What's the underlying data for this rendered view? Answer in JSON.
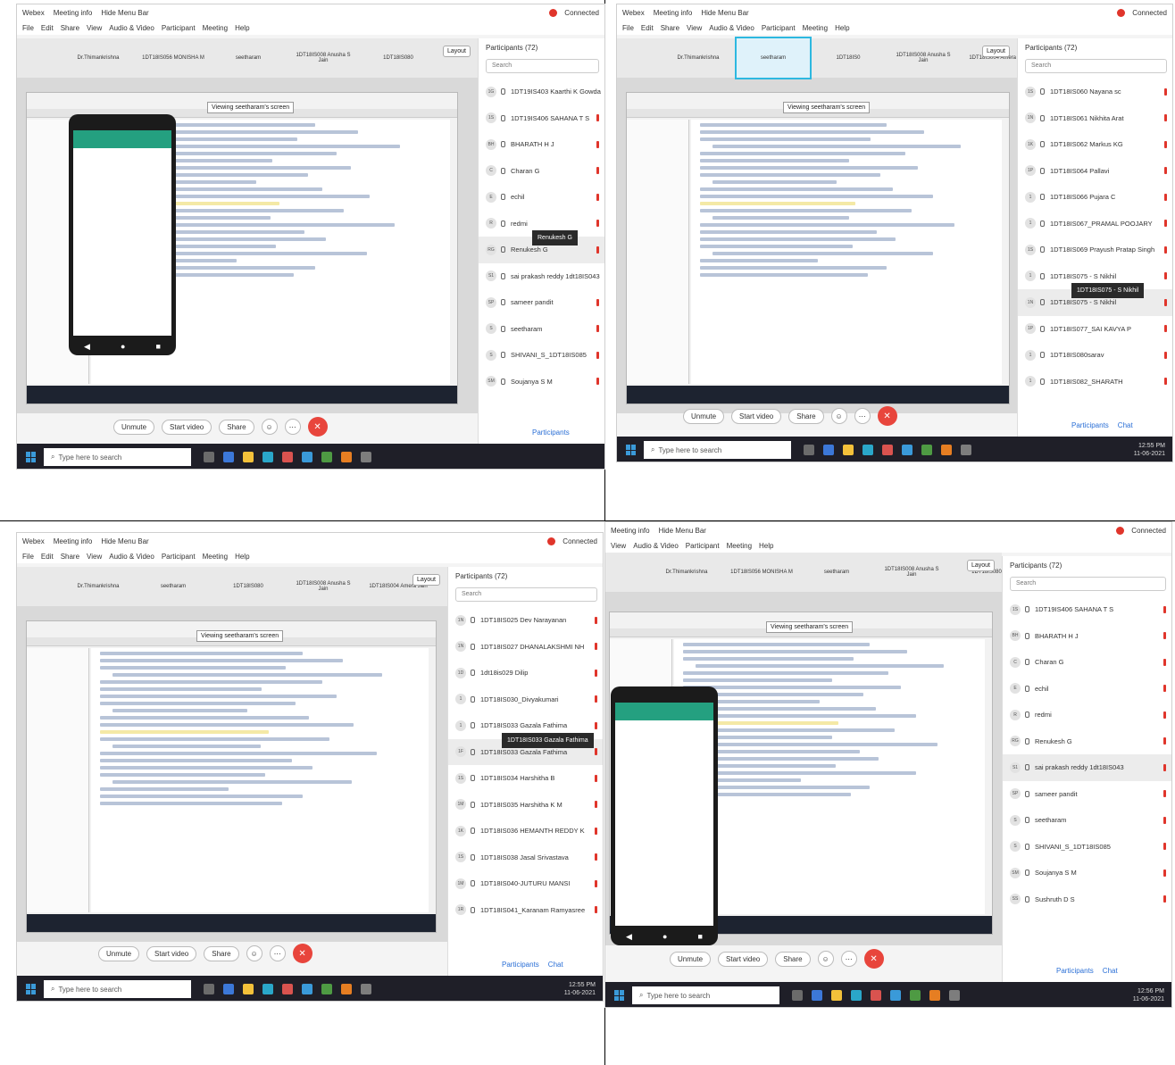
{
  "quadrants": [
    {
      "titlebar": {
        "app": "Webex",
        "meeting_info": "Meeting info",
        "hide_menu": "Hide Menu Bar",
        "status": "Connected"
      },
      "menu": [
        "File",
        "Edit",
        "Share",
        "View",
        "Audio & Video",
        "Participant",
        "Meeting",
        "Help"
      ],
      "thumbs": [
        "Dr.Thimankrishna",
        "1DT18IS056 MONISHA M",
        "seetharam",
        "1DT18IS008 Anusha S Jain",
        "1DT18IS080"
      ],
      "selected_thumb": -1,
      "layout_label": "Layout",
      "banner": "Viewing seetharam's screen",
      "show_phone": true,
      "controls": {
        "unmute": "Unmute",
        "start_video": "Start video",
        "share": "Share",
        "participants": "Participants",
        "chat": ""
      },
      "panel": {
        "title": "Participants (72)",
        "search": "Search",
        "rows": [
          {
            "av": "1G",
            "name": "1DT19IS403 Kaarthi K Gowda"
          },
          {
            "av": "1S",
            "name": "1DT19IS406 SAHANA T S"
          },
          {
            "av": "BH",
            "name": "BHARATH H J"
          },
          {
            "av": "C",
            "name": "Charan G"
          },
          {
            "av": "E",
            "name": "echil"
          },
          {
            "av": "R",
            "name": "redmi"
          },
          {
            "av": "RG",
            "name": "Renukesh G"
          },
          {
            "av": "S1",
            "name": "sai prakash reddy 1dt18IS043"
          },
          {
            "av": "SP",
            "name": "sameer pandit"
          },
          {
            "av": "S",
            "name": "seetharam"
          },
          {
            "av": "S",
            "name": "SHIVANI_S_1DT18IS085"
          },
          {
            "av": "SM",
            "name": "Soujanya S M"
          }
        ],
        "hover_index": 6,
        "tooltip": "Renukesh G"
      },
      "taskbar": {
        "search": "Type here to search",
        "time": "",
        "date": ""
      }
    },
    {
      "titlebar": {
        "app": "Webex",
        "meeting_info": "Meeting info",
        "hide_menu": "Hide Menu Bar",
        "status": "Connected"
      },
      "menu": [
        "File",
        "Edit",
        "Share",
        "View",
        "Audio & Video",
        "Participant",
        "Meeting",
        "Help"
      ],
      "thumbs": [
        "Dr.Thimankrishna",
        "seetharam",
        "1DT18IS0",
        "1DT18IS008 Anusha S Jain",
        "1DT18IS004 Amera Jain"
      ],
      "selected_thumb": 1,
      "layout_label": "Layout",
      "banner": "Viewing seetharam's screen",
      "show_phone": false,
      "controls": {
        "unmute": "Unmute",
        "start_video": "Start video",
        "share": "Share",
        "participants": "Participants",
        "chat": "Chat"
      },
      "panel": {
        "title": "Participants (72)",
        "search": "Search",
        "rows": [
          {
            "av": "1S",
            "name": "1DT18IS060 Nayana sc"
          },
          {
            "av": "1N",
            "name": "1DT18IS061 Nikhita Arat"
          },
          {
            "av": "1K",
            "name": "1DT18IS062 Markus KG"
          },
          {
            "av": "1P",
            "name": "1DT18IS064 Pallavi"
          },
          {
            "av": "1",
            "name": "1DT18IS066 Pujara C"
          },
          {
            "av": "1",
            "name": "1DT18IS067_PRAMAL POOJARY"
          },
          {
            "av": "1S",
            "name": "1DT18IS069 Prayush Pratap Singh"
          },
          {
            "av": "1",
            "name": "1DT18IS075 - S Nikhil"
          },
          {
            "av": "1N",
            "name": "1DT18IS075 - S Nikhil"
          },
          {
            "av": "1P",
            "name": "1DT18IS077_SAI KAVYA P"
          },
          {
            "av": "1",
            "name": "1DT18IS080sarav"
          },
          {
            "av": "1",
            "name": "1DT18IS082_SHARATH"
          }
        ],
        "hover_index": 8,
        "tooltip": "1DT18IS075 - S Nikhil"
      },
      "taskbar": {
        "search": "Type here to search",
        "time": "12:55 PM",
        "date": "11-06-2021"
      }
    },
    {
      "titlebar": {
        "app": "Webex",
        "meeting_info": "Meeting info",
        "hide_menu": "Hide Menu Bar",
        "status": "Connected"
      },
      "menu": [
        "File",
        "Edit",
        "Share",
        "View",
        "Audio & Video",
        "Participant",
        "Meeting",
        "Help"
      ],
      "thumbs": [
        "Dr.Thimankrishna",
        "seetharam",
        "1DT18IS080",
        "1DT18IS008 Anusha S Jain",
        "1DT18IS004 Amera Jain"
      ],
      "selected_thumb": -1,
      "layout_label": "Layout",
      "banner": "Viewing seetharam's screen",
      "show_phone": false,
      "controls": {
        "unmute": "Unmute",
        "start_video": "Start video",
        "share": "Share",
        "participants": "Participants",
        "chat": "Chat"
      },
      "panel": {
        "title": "Participants (72)",
        "search": "Search",
        "rows": [
          {
            "av": "1N",
            "name": "1DT18IS025 Dev Narayanan"
          },
          {
            "av": "1N",
            "name": "1DT18IS027 DHANALAKSHMI NH"
          },
          {
            "av": "1D",
            "name": "1dt18is029 Dilip"
          },
          {
            "av": "1",
            "name": "1DT18IS030_Divyakumari"
          },
          {
            "av": "1",
            "name": "1DT18IS033 Gazala Fathima"
          },
          {
            "av": "1F",
            "name": "1DT18IS033 Gazala Fathima"
          },
          {
            "av": "1S",
            "name": "1DT18IS034 Harshitha B"
          },
          {
            "av": "1M",
            "name": "1DT18IS035 Harshitha K M"
          },
          {
            "av": "1K",
            "name": "1DT18IS036 HEMANTH REDDY K"
          },
          {
            "av": "1S",
            "name": "1DT18IS038 Jasal Srivastava"
          },
          {
            "av": "1M",
            "name": "1DT18IS040-JUTURU MANSI"
          },
          {
            "av": "1R",
            "name": "1DT18IS041_Karanam Ramyasree"
          }
        ],
        "hover_index": 5,
        "tooltip": "1DT18IS033 Gazala Fathima"
      },
      "taskbar": {
        "search": "Type here to search",
        "time": "12:55 PM",
        "date": "11-06-2021"
      }
    },
    {
      "titlebar": {
        "app": "",
        "meeting_info": "Meeting info",
        "hide_menu": "Hide Menu Bar",
        "status": "Connected"
      },
      "menu": [
        "View",
        "Audio & Video",
        "Participant",
        "Meeting",
        "Help"
      ],
      "thumbs": [
        "Dr.Thimankrishna",
        "1DT18IS056 MONISHA M",
        "seetharam",
        "1DT18IS008 Anusha S Jain",
        "1DT18IS080"
      ],
      "selected_thumb": -1,
      "layout_label": "Layout",
      "banner": "Viewing seetharam's screen",
      "show_phone": true,
      "controls": {
        "unmute": "Unmute",
        "start_video": "Start video",
        "share": "Share",
        "participants": "Participants",
        "chat": "Chat"
      },
      "panel": {
        "title": "Participants (72)",
        "search": "Search",
        "rows": [
          {
            "av": "1S",
            "name": "1DT19IS406 SAHANA T S"
          },
          {
            "av": "BH",
            "name": "BHARATH H J"
          },
          {
            "av": "C",
            "name": "Charan G"
          },
          {
            "av": "E",
            "name": "echil"
          },
          {
            "av": "R",
            "name": "redmi"
          },
          {
            "av": "RG",
            "name": "Renukesh G"
          },
          {
            "av": "S1",
            "name": "sai prakash reddy 1dt18IS043"
          },
          {
            "av": "SP",
            "name": "sameer pandit"
          },
          {
            "av": "S",
            "name": "seetharam"
          },
          {
            "av": "S",
            "name": "SHIVANI_S_1DT18IS085"
          },
          {
            "av": "SM",
            "name": "Soujanya S M"
          },
          {
            "av": "SS",
            "name": "Sushruth D S"
          }
        ],
        "hover_index": 6,
        "tooltip": ""
      },
      "taskbar": {
        "search": "Type here to search",
        "time": "12:56 PM",
        "date": "11-06-2021"
      }
    }
  ]
}
